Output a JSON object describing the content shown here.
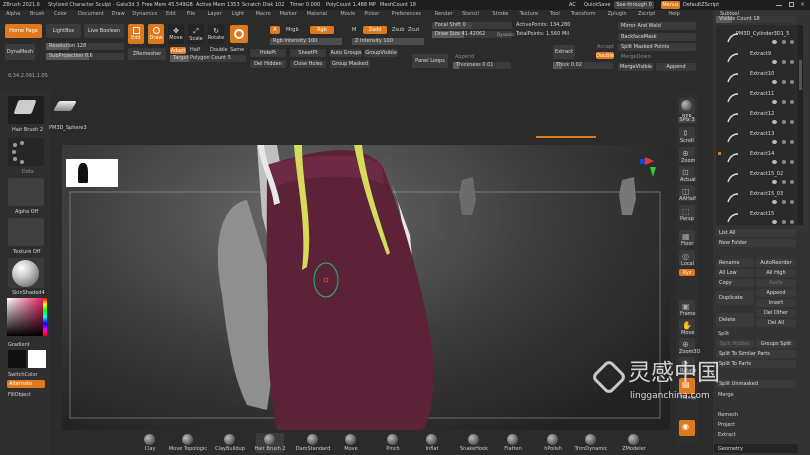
{
  "titlebar": {
    "app": "ZBrush 2021.6",
    "project": "Stylized Character Sculpt - Gate3d 3",
    "stats": [
      "Free Mem 45.549GB",
      "Active Mem 1353",
      "Scratch Disk 102",
      "Timer 0.000",
      "PolyCount 1.488 MP",
      "MeshCount 18"
    ],
    "ac": "AC",
    "quicksave": "QuickSave",
    "seethrough": "See-through 0",
    "menus_btn": "Menus",
    "script": "DefaultZScript"
  },
  "menus": [
    "Alpha",
    "Brush",
    "Color",
    "Document",
    "Draw",
    "Dynamics",
    "Edit",
    "File",
    "Layer",
    "Light",
    "Macro",
    "Marker",
    "Material",
    "Movie",
    "Picker",
    "Preferences",
    "Render",
    "Stencil",
    "Stroke",
    "Texture",
    "Tool",
    "Transform",
    "Zplugin",
    "Zscript",
    "Help"
  ],
  "shelf": {
    "home": "Home Page",
    "lightbox": "LightBox",
    "liveboolean": "Live Boolean",
    "dynamesh": "DynaMesh",
    "resolution": "Resolution 128",
    "subprojection": "SubProjection 0.6",
    "version": "0.34.2.091.1.05",
    "edit": "Edit",
    "draw": "Draw",
    "move": "Move",
    "scale": "Scale",
    "rotate": "Rotate",
    "zremesher": "ZRemesher",
    "adapt": "Adapt",
    "half": "Half",
    "same": "Same",
    "double": "Double",
    "target": "Target Polygon Count 5",
    "a": "A",
    "mrgb": "Mrgb",
    "rgb": "Rgb",
    "m": "M",
    "zadd": "Zadd",
    "zsub": "Zsub",
    "zcut": "Zcut",
    "rgb_intensity": "Rgb Intensity 100",
    "z_intensity": "Z Intensity 100",
    "hidept": "HidePt",
    "sheetpt": "SheetPt",
    "autogroups": "Auto Groups",
    "groupvisible": "GroupVisible",
    "delhidden": "Del Hidden",
    "closeholes": "Close Holes",
    "groupmasked": "Group Masked",
    "panelloops": "Panel Loops",
    "append": "Append",
    "thickness": "Thickness 0.01",
    "focalshift": "Focal Shift 0",
    "drawsize": "Draw Size 41.42062",
    "dynamic": "Dynamic",
    "activepoints": "ActivePoints: 134,280",
    "totalpoints": "TotalPoints: 1.560 Mil",
    "extract": "Extract",
    "accept": "Accept",
    "double2": "Double",
    "thick": "Thick 0.02",
    "mirrorweld": "Mirror And Weld",
    "backfacemask": "BackfaceMask",
    "splitmasked": "Split Masked Points",
    "mergedown": "MergeDown",
    "mergevisible": "MergeVisible",
    "append2": "Append"
  },
  "left": {
    "brush": "Hair Brush 2",
    "dots": "Dots",
    "alpha": "Alpha Off",
    "texture": "Texture Off",
    "material": "SkinShaded4",
    "gradient": "Gradient",
    "switchcolor": "SwitchColor",
    "alternate": "Alternate",
    "fillobject": "FillObject"
  },
  "toolname": "PM3D_Sphere3",
  "rightbar": {
    "bpr": "BPR",
    "spix": "SPix 3",
    "scroll": "Scroll",
    "zoom": "Zoom",
    "actual": "Actual",
    "aahalf": "AAHalf",
    "persp": "Persp",
    "floor": "Floor",
    "local": "Local",
    "xyz": "Xyz",
    "frame": "Frame",
    "move": "Move",
    "zoom3d": "Zoom3D",
    "rotate": "Rotate",
    "transp": "Transp",
    "dynamic": "Dynamic",
    "solo": "Solo",
    "xpose": "Xpose"
  },
  "subtool": {
    "header": "Subtool",
    "visible": "Visible Count 18",
    "items": [
      "PM3D_Cylinder3D1_5",
      "Extract9",
      "Extract10",
      "Extract11",
      "Extract12",
      "Extract13",
      "Extract14",
      "Extract15_02",
      "Extract15_03",
      "Extract15"
    ],
    "listall": "List All",
    "newfolder": "New Folder",
    "rename": "Rename",
    "autoreorder": "AutoReorder",
    "alllow": "All Low",
    "allhigh": "All High",
    "copy": "Copy",
    "paste": "Paste",
    "duplicate": "Duplicate",
    "append": "Append",
    "insert": "Insert",
    "delete": "Delete",
    "delother": "Del Other",
    "delall": "Del All",
    "split": "Split",
    "splithidden": "Split Hidden",
    "groupssplit": "Groups Split",
    "splitsimilar": "Split To Similar Parts",
    "splitparts": "Split To Parts",
    "splitunmasked": "Split Unmasked",
    "merge": "Merge",
    "remesh": "Remesh",
    "project": "Project",
    "extract": "Extract",
    "geometry": "Geometry"
  },
  "brushes": [
    "Clay",
    "Move Topologic",
    "ClayBuildup",
    "Hair Brush 2",
    "DamStandard",
    "Move",
    "Pinch",
    "Inflat",
    "SnakeHook",
    "Flatten",
    "hPolish",
    "TrimDynamic",
    "ZModeler"
  ],
  "watermark": {
    "cn": "灵感中国",
    "url": "lingganchina.com"
  },
  "colors": {
    "accent": "#e0791c",
    "bg": "#2b2b2b",
    "panel": "#3b3b3b",
    "hair": "#d5db5a",
    "cloth": "#5c2238"
  }
}
